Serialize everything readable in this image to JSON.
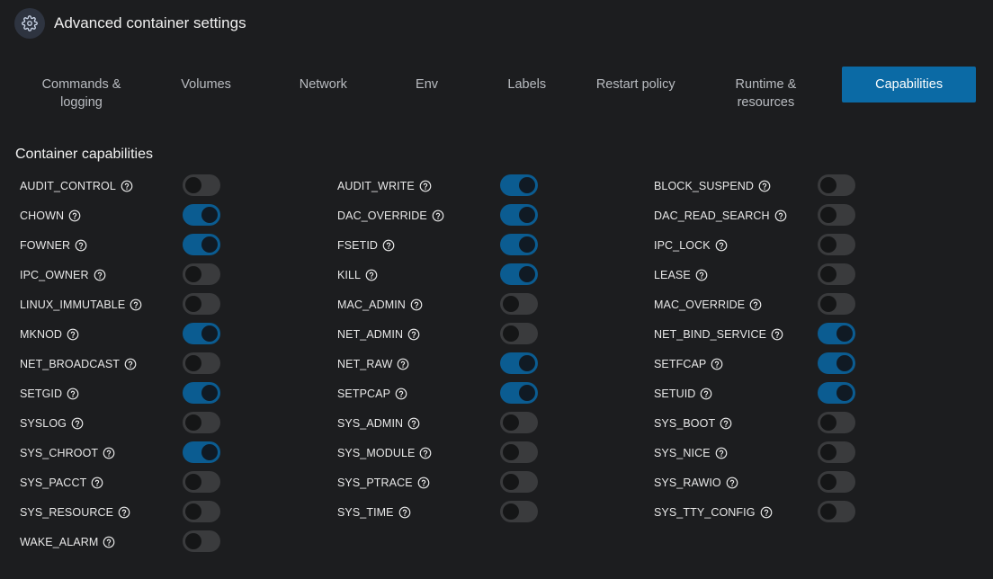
{
  "header": {
    "title": "Advanced container settings"
  },
  "tabs": [
    {
      "label": "Commands & logging",
      "active": false
    },
    {
      "label": "Volumes",
      "active": false
    },
    {
      "label": "Network",
      "active": false
    },
    {
      "label": "Env",
      "active": false
    },
    {
      "label": "Labels",
      "active": false
    },
    {
      "label": "Restart policy",
      "active": false
    },
    {
      "label": "Runtime & resources",
      "active": false
    },
    {
      "label": "Capabilities",
      "active": true
    }
  ],
  "section_title": "Container capabilities",
  "capabilities": [
    [
      {
        "name": "AUDIT_CONTROL",
        "enabled": false
      },
      {
        "name": "CHOWN",
        "enabled": true
      },
      {
        "name": "FOWNER",
        "enabled": true
      },
      {
        "name": "IPC_OWNER",
        "enabled": false
      },
      {
        "name": "LINUX_IMMUTABLE",
        "enabled": false
      },
      {
        "name": "MKNOD",
        "enabled": true
      },
      {
        "name": "NET_BROADCAST",
        "enabled": false
      },
      {
        "name": "SETGID",
        "enabled": true
      },
      {
        "name": "SYSLOG",
        "enabled": false
      },
      {
        "name": "SYS_CHROOT",
        "enabled": true
      },
      {
        "name": "SYS_PACCT",
        "enabled": false
      },
      {
        "name": "SYS_RESOURCE",
        "enabled": false
      },
      {
        "name": "WAKE_ALARM",
        "enabled": false
      }
    ],
    [
      {
        "name": "AUDIT_WRITE",
        "enabled": true
      },
      {
        "name": "DAC_OVERRIDE",
        "enabled": true
      },
      {
        "name": "FSETID",
        "enabled": true
      },
      {
        "name": "KILL",
        "enabled": true
      },
      {
        "name": "MAC_ADMIN",
        "enabled": false
      },
      {
        "name": "NET_ADMIN",
        "enabled": false
      },
      {
        "name": "NET_RAW",
        "enabled": true
      },
      {
        "name": "SETPCAP",
        "enabled": true
      },
      {
        "name": "SYS_ADMIN",
        "enabled": false
      },
      {
        "name": "SYS_MODULE",
        "enabled": false
      },
      {
        "name": "SYS_PTRACE",
        "enabled": false
      },
      {
        "name": "SYS_TIME",
        "enabled": false
      }
    ],
    [
      {
        "name": "BLOCK_SUSPEND",
        "enabled": false
      },
      {
        "name": "DAC_READ_SEARCH",
        "enabled": false
      },
      {
        "name": "IPC_LOCK",
        "enabled": false
      },
      {
        "name": "LEASE",
        "enabled": false
      },
      {
        "name": "MAC_OVERRIDE",
        "enabled": false
      },
      {
        "name": "NET_BIND_SERVICE",
        "enabled": true
      },
      {
        "name": "SETFCAP",
        "enabled": true
      },
      {
        "name": "SETUID",
        "enabled": true
      },
      {
        "name": "SYS_BOOT",
        "enabled": false
      },
      {
        "name": "SYS_NICE",
        "enabled": false
      },
      {
        "name": "SYS_RAWIO",
        "enabled": false
      },
      {
        "name": "SYS_TTY_CONFIG",
        "enabled": false
      }
    ]
  ],
  "icons": {
    "header": "gear-icon",
    "help": "question-circle-icon"
  },
  "colors": {
    "background": "#1c1d1f",
    "accent": "#0b6aa5",
    "toggle_on": "#0b5c91",
    "toggle_off": "#3a3b3d"
  }
}
